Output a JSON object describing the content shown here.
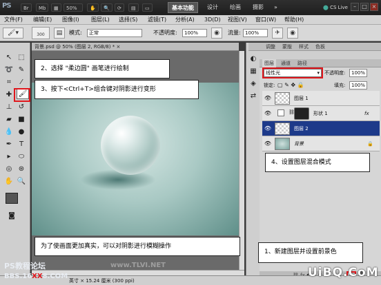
{
  "app": {
    "logo": "PS",
    "workspaces": {
      "active": "基本功能",
      "items": [
        "设计",
        "绘画",
        "摄影"
      ],
      "more": "»"
    },
    "zoom_select": "50%",
    "cs_live": "CS Live"
  },
  "menu": [
    "文件(F)",
    "编辑(E)",
    "图像(I)",
    "图层(L)",
    "选择(S)",
    "滤镜(T)",
    "分析(A)",
    "3D(D)",
    "视图(V)",
    "窗口(W)",
    "帮助(H)"
  ],
  "options": {
    "brush_size": "300",
    "mode_label": "模式:",
    "mode_value": "正常",
    "opacity_label": "不透明度:",
    "opacity_value": "100%",
    "flow_label": "流量:",
    "flow_value": "100%"
  },
  "document": {
    "tab": "背景.psd @ 50% (图层 2, RGB/8) *",
    "close": "×"
  },
  "panels": {
    "top_tabs": [
      "调整",
      "蒙版",
      "样式",
      "色板"
    ],
    "layer_tabs": [
      "图层",
      "通道",
      "路径"
    ],
    "blend_mode": "线性光",
    "opacity_label": "不透明度:",
    "opacity_value": "100%",
    "lock_label": "锁定:",
    "fill_label": "填充:",
    "fill_value": "100%",
    "layers": [
      {
        "name": "图层 1",
        "selected": false
      },
      {
        "name": "形状 1",
        "selected": false,
        "fx": "fx"
      },
      {
        "name": "图层 2",
        "selected": true
      },
      {
        "name": "背景",
        "selected": false
      }
    ]
  },
  "callouts": {
    "c1": "2、选择 \"柔边圆\" 画笔进行绘制",
    "c2": "3、按下<Ctrl+T>组合键对阴影进行变形",
    "c3": "4、设置图层混合模式",
    "c4": "为了使画面更加真实，可以对阴影进行模糊操作",
    "c5": "1、新建图层并设置前景色"
  },
  "status": {
    "size": "英寸 × 15.24 厘米 (300 ppi)"
  },
  "watermarks": {
    "forum": "PS教程论坛",
    "bbs": "BBS.16",
    "xx": "XX",
    "bbs_end": "8.COM",
    "tlvi": "www.TLVI.NET",
    "uibq": "UiBQ.CoM"
  },
  "colors": {
    "accent_red": "#e0151b",
    "layer_selected": "#1d3a8a"
  }
}
